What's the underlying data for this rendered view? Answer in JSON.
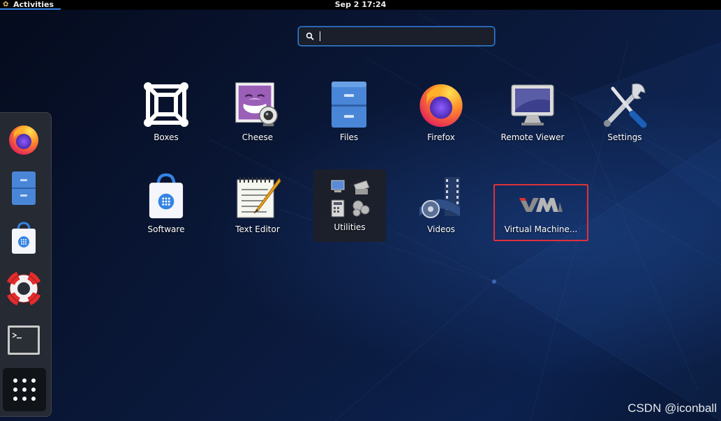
{
  "topbar": {
    "activities_label": "Activities",
    "clock": "Sep 2  17:24"
  },
  "search": {
    "value": "",
    "icon": "search-icon"
  },
  "dash": {
    "items": [
      {
        "name": "Firefox",
        "icon": "firefox-icon"
      },
      {
        "name": "Files",
        "icon": "files-icon"
      },
      {
        "name": "Software",
        "icon": "software-icon"
      },
      {
        "name": "Help",
        "icon": "help-lifebuoy-icon"
      },
      {
        "name": "Terminal",
        "icon": "terminal-icon"
      }
    ],
    "show_apps_icon": "show-apps-grid-icon"
  },
  "apps": [
    {
      "label": "Boxes",
      "icon": "boxes-icon"
    },
    {
      "label": "Cheese",
      "icon": "cheese-icon"
    },
    {
      "label": "Files",
      "icon": "files-icon"
    },
    {
      "label": "Firefox",
      "icon": "firefox-icon"
    },
    {
      "label": "Remote Viewer",
      "icon": "remote-viewer-icon"
    },
    {
      "label": "Settings",
      "icon": "settings-icon"
    },
    {
      "label": "Software",
      "icon": "software-icon"
    },
    {
      "label": "Text Editor",
      "icon": "text-editor-icon"
    },
    {
      "label": "Utilities",
      "icon": "utilities-folder-icon"
    },
    {
      "label": "Videos",
      "icon": "videos-icon"
    },
    {
      "label": "Virtual Machine...",
      "icon": "virtual-machine-manager-icon"
    }
  ],
  "watermark": "CSDN @iconball",
  "colors": {
    "accent": "#3584e4",
    "highlight_box": "#e0303a"
  }
}
